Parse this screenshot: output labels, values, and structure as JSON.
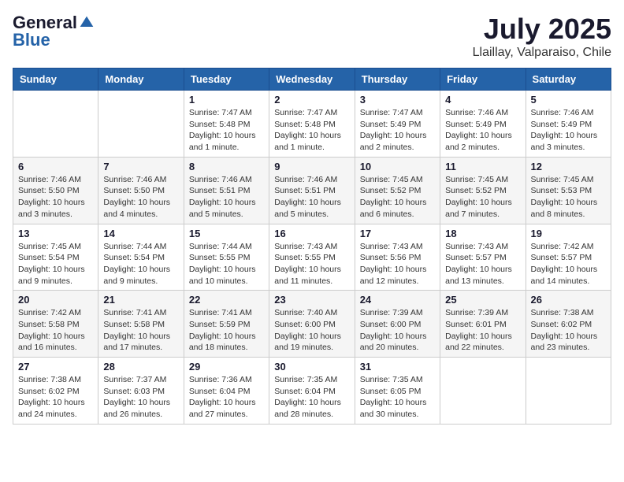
{
  "logo": {
    "general": "General",
    "blue": "Blue"
  },
  "title": {
    "month_year": "July 2025",
    "location": "Llaillay, Valparaiso, Chile"
  },
  "headers": [
    "Sunday",
    "Monday",
    "Tuesday",
    "Wednesday",
    "Thursday",
    "Friday",
    "Saturday"
  ],
  "weeks": [
    [
      {
        "day": "",
        "sunrise": "",
        "sunset": "",
        "daylight": ""
      },
      {
        "day": "",
        "sunrise": "",
        "sunset": "",
        "daylight": ""
      },
      {
        "day": "1",
        "sunrise": "Sunrise: 7:47 AM",
        "sunset": "Sunset: 5:48 PM",
        "daylight": "Daylight: 10 hours and 1 minute."
      },
      {
        "day": "2",
        "sunrise": "Sunrise: 7:47 AM",
        "sunset": "Sunset: 5:48 PM",
        "daylight": "Daylight: 10 hours and 1 minute."
      },
      {
        "day": "3",
        "sunrise": "Sunrise: 7:47 AM",
        "sunset": "Sunset: 5:49 PM",
        "daylight": "Daylight: 10 hours and 2 minutes."
      },
      {
        "day": "4",
        "sunrise": "Sunrise: 7:46 AM",
        "sunset": "Sunset: 5:49 PM",
        "daylight": "Daylight: 10 hours and 2 minutes."
      },
      {
        "day": "5",
        "sunrise": "Sunrise: 7:46 AM",
        "sunset": "Sunset: 5:49 PM",
        "daylight": "Daylight: 10 hours and 3 minutes."
      }
    ],
    [
      {
        "day": "6",
        "sunrise": "Sunrise: 7:46 AM",
        "sunset": "Sunset: 5:50 PM",
        "daylight": "Daylight: 10 hours and 3 minutes."
      },
      {
        "day": "7",
        "sunrise": "Sunrise: 7:46 AM",
        "sunset": "Sunset: 5:50 PM",
        "daylight": "Daylight: 10 hours and 4 minutes."
      },
      {
        "day": "8",
        "sunrise": "Sunrise: 7:46 AM",
        "sunset": "Sunset: 5:51 PM",
        "daylight": "Daylight: 10 hours and 5 minutes."
      },
      {
        "day": "9",
        "sunrise": "Sunrise: 7:46 AM",
        "sunset": "Sunset: 5:51 PM",
        "daylight": "Daylight: 10 hours and 5 minutes."
      },
      {
        "day": "10",
        "sunrise": "Sunrise: 7:45 AM",
        "sunset": "Sunset: 5:52 PM",
        "daylight": "Daylight: 10 hours and 6 minutes."
      },
      {
        "day": "11",
        "sunrise": "Sunrise: 7:45 AM",
        "sunset": "Sunset: 5:52 PM",
        "daylight": "Daylight: 10 hours and 7 minutes."
      },
      {
        "day": "12",
        "sunrise": "Sunrise: 7:45 AM",
        "sunset": "Sunset: 5:53 PM",
        "daylight": "Daylight: 10 hours and 8 minutes."
      }
    ],
    [
      {
        "day": "13",
        "sunrise": "Sunrise: 7:45 AM",
        "sunset": "Sunset: 5:54 PM",
        "daylight": "Daylight: 10 hours and 9 minutes."
      },
      {
        "day": "14",
        "sunrise": "Sunrise: 7:44 AM",
        "sunset": "Sunset: 5:54 PM",
        "daylight": "Daylight: 10 hours and 9 minutes."
      },
      {
        "day": "15",
        "sunrise": "Sunrise: 7:44 AM",
        "sunset": "Sunset: 5:55 PM",
        "daylight": "Daylight: 10 hours and 10 minutes."
      },
      {
        "day": "16",
        "sunrise": "Sunrise: 7:43 AM",
        "sunset": "Sunset: 5:55 PM",
        "daylight": "Daylight: 10 hours and 11 minutes."
      },
      {
        "day": "17",
        "sunrise": "Sunrise: 7:43 AM",
        "sunset": "Sunset: 5:56 PM",
        "daylight": "Daylight: 10 hours and 12 minutes."
      },
      {
        "day": "18",
        "sunrise": "Sunrise: 7:43 AM",
        "sunset": "Sunset: 5:57 PM",
        "daylight": "Daylight: 10 hours and 13 minutes."
      },
      {
        "day": "19",
        "sunrise": "Sunrise: 7:42 AM",
        "sunset": "Sunset: 5:57 PM",
        "daylight": "Daylight: 10 hours and 14 minutes."
      }
    ],
    [
      {
        "day": "20",
        "sunrise": "Sunrise: 7:42 AM",
        "sunset": "Sunset: 5:58 PM",
        "daylight": "Daylight: 10 hours and 16 minutes."
      },
      {
        "day": "21",
        "sunrise": "Sunrise: 7:41 AM",
        "sunset": "Sunset: 5:58 PM",
        "daylight": "Daylight: 10 hours and 17 minutes."
      },
      {
        "day": "22",
        "sunrise": "Sunrise: 7:41 AM",
        "sunset": "Sunset: 5:59 PM",
        "daylight": "Daylight: 10 hours and 18 minutes."
      },
      {
        "day": "23",
        "sunrise": "Sunrise: 7:40 AM",
        "sunset": "Sunset: 6:00 PM",
        "daylight": "Daylight: 10 hours and 19 minutes."
      },
      {
        "day": "24",
        "sunrise": "Sunrise: 7:39 AM",
        "sunset": "Sunset: 6:00 PM",
        "daylight": "Daylight: 10 hours and 20 minutes."
      },
      {
        "day": "25",
        "sunrise": "Sunrise: 7:39 AM",
        "sunset": "Sunset: 6:01 PM",
        "daylight": "Daylight: 10 hours and 22 minutes."
      },
      {
        "day": "26",
        "sunrise": "Sunrise: 7:38 AM",
        "sunset": "Sunset: 6:02 PM",
        "daylight": "Daylight: 10 hours and 23 minutes."
      }
    ],
    [
      {
        "day": "27",
        "sunrise": "Sunrise: 7:38 AM",
        "sunset": "Sunset: 6:02 PM",
        "daylight": "Daylight: 10 hours and 24 minutes."
      },
      {
        "day": "28",
        "sunrise": "Sunrise: 7:37 AM",
        "sunset": "Sunset: 6:03 PM",
        "daylight": "Daylight: 10 hours and 26 minutes."
      },
      {
        "day": "29",
        "sunrise": "Sunrise: 7:36 AM",
        "sunset": "Sunset: 6:04 PM",
        "daylight": "Daylight: 10 hours and 27 minutes."
      },
      {
        "day": "30",
        "sunrise": "Sunrise: 7:35 AM",
        "sunset": "Sunset: 6:04 PM",
        "daylight": "Daylight: 10 hours and 28 minutes."
      },
      {
        "day": "31",
        "sunrise": "Sunrise: 7:35 AM",
        "sunset": "Sunset: 6:05 PM",
        "daylight": "Daylight: 10 hours and 30 minutes."
      },
      {
        "day": "",
        "sunrise": "",
        "sunset": "",
        "daylight": ""
      },
      {
        "day": "",
        "sunrise": "",
        "sunset": "",
        "daylight": ""
      }
    ]
  ]
}
